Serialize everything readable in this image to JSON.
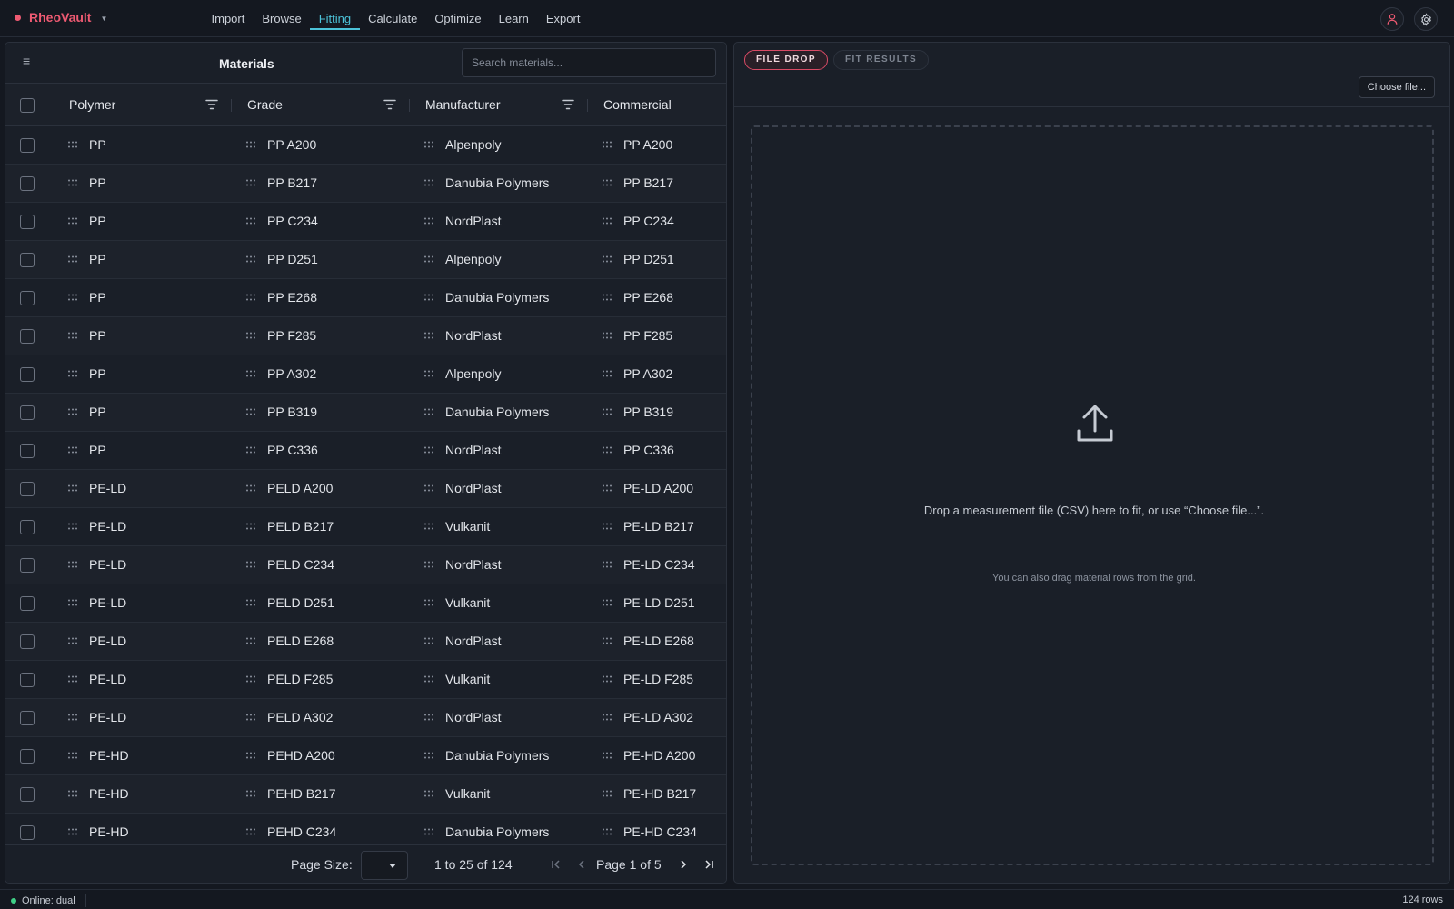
{
  "app": {
    "name": "RheoVault",
    "brand_color": "#ee5a72",
    "accent_color": "#4cc3d9"
  },
  "nav": [
    {
      "label": "Import",
      "active": false
    },
    {
      "label": "Browse",
      "active": false
    },
    {
      "label": "Fitting",
      "active": true
    },
    {
      "label": "Calculate",
      "active": false
    },
    {
      "label": "Optimize",
      "active": false
    },
    {
      "label": "Learn",
      "active": false
    },
    {
      "label": "Export",
      "active": false
    }
  ],
  "header_icons": [
    "user-icon",
    "gear-icon"
  ],
  "materials": {
    "title": "Materials",
    "search_placeholder": "Search materials...",
    "columns": [
      "Polymer",
      "Grade",
      "Manufacturer",
      "Commercial"
    ],
    "rows": [
      [
        "PP",
        "PP A200",
        "Alpenpoly",
        "PP A200"
      ],
      [
        "PP",
        "PP B217",
        "Danubia Polymers",
        "PP B217"
      ],
      [
        "PP",
        "PP C234",
        "NordPlast",
        "PP C234"
      ],
      [
        "PP",
        "PP D251",
        "Alpenpoly",
        "PP D251"
      ],
      [
        "PP",
        "PP E268",
        "Danubia Polymers",
        "PP E268"
      ],
      [
        "PP",
        "PP F285",
        "NordPlast",
        "PP F285"
      ],
      [
        "PP",
        "PP A302",
        "Alpenpoly",
        "PP A302"
      ],
      [
        "PP",
        "PP B319",
        "Danubia Polymers",
        "PP B319"
      ],
      [
        "PP",
        "PP C336",
        "NordPlast",
        "PP C336"
      ],
      [
        "PE-LD",
        "PELD A200",
        "NordPlast",
        "PE-LD A200"
      ],
      [
        "PE-LD",
        "PELD B217",
        "Vulkanit",
        "PE-LD B217"
      ],
      [
        "PE-LD",
        "PELD C234",
        "NordPlast",
        "PE-LD C234"
      ],
      [
        "PE-LD",
        "PELD D251",
        "Vulkanit",
        "PE-LD D251"
      ],
      [
        "PE-LD",
        "PELD E268",
        "NordPlast",
        "PE-LD E268"
      ],
      [
        "PE-LD",
        "PELD F285",
        "Vulkanit",
        "PE-LD F285"
      ],
      [
        "PE-LD",
        "PELD A302",
        "NordPlast",
        "PE-LD A302"
      ],
      [
        "PE-HD",
        "PEHD A200",
        "Danubia Polymers",
        "PE-HD A200"
      ],
      [
        "PE-HD",
        "PEHD B217",
        "Vulkanit",
        "PE-HD B217"
      ],
      [
        "PE-HD",
        "PEHD C234",
        "Danubia Polymers",
        "PE-HD C234"
      ]
    ],
    "pagination": {
      "page_size_label": "Page Size:",
      "range_text": "1 to 25 of 124",
      "page_word": "Page",
      "current_page": "1",
      "of_word": "of",
      "total_pages": "5"
    }
  },
  "fitting": {
    "tabs": [
      {
        "label": "FILE DROP",
        "active": true
      },
      {
        "label": "FIT RESULTS",
        "active": false
      }
    ],
    "choose_file_label": "Choose file...",
    "drop_text": "Drop a measurement file (CSV) here to fit, or use “Choose file...”.",
    "drop_sub": "You can also drag material rows from the grid.",
    "tab_active_color": "#d94a65"
  },
  "status": {
    "left": "Online: dual",
    "right": "124 rows",
    "online_color": "#3fcf86"
  }
}
